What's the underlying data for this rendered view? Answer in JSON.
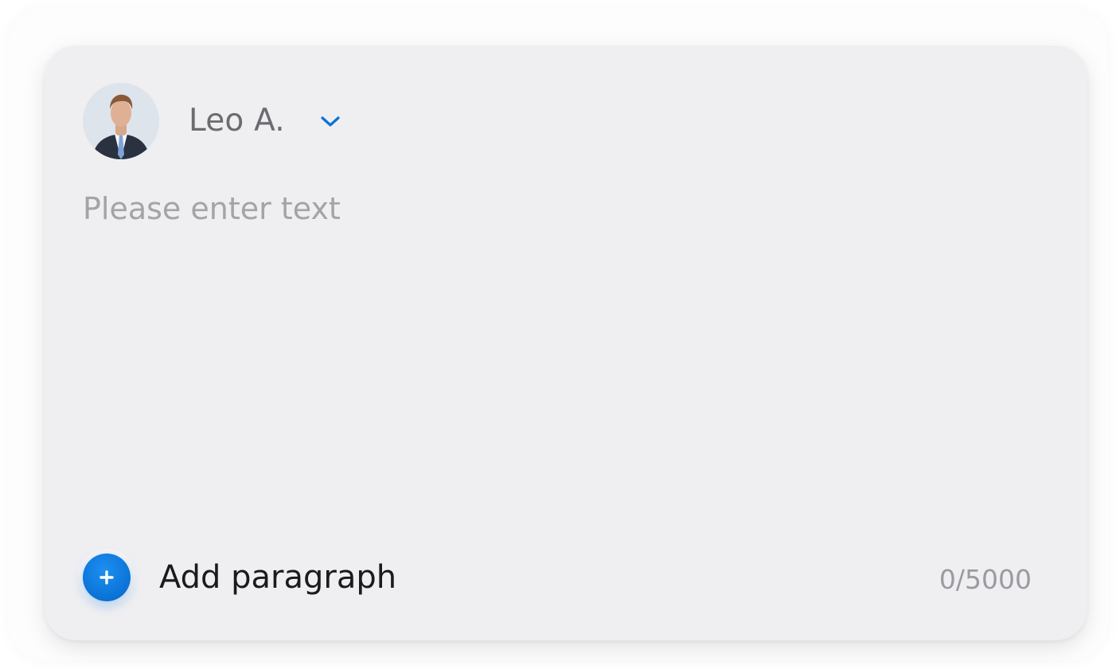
{
  "author": {
    "name": "Leo A.",
    "avatar_icon": "person-avatar"
  },
  "composer": {
    "placeholder": "Please enter text",
    "value": ""
  },
  "footer": {
    "add_label": "Add paragraph",
    "add_icon": "plus-icon",
    "counter": "0/5000"
  },
  "colors": {
    "accent": "#0b72d6",
    "card_background": "#efeff2",
    "placeholder": "#a3a3a8"
  }
}
